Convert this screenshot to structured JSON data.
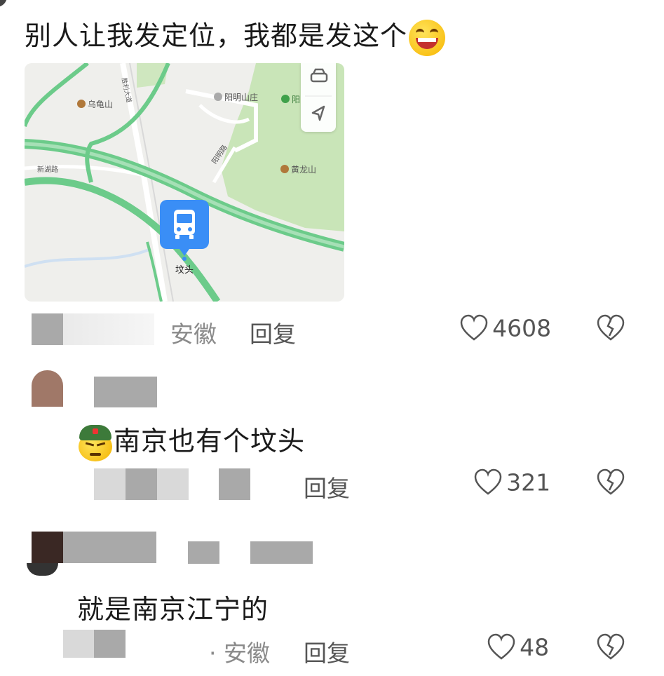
{
  "post": {
    "text": "别人让我发定位，我都是发这个",
    "emoji": "laughing-squinting-emoji",
    "map": {
      "labels": {
        "wuguishan": "乌龟山",
        "yangmingshanzhuang": "阳明山庄",
        "yang": "阳",
        "huanglongshan": "黄龙山",
        "yangminglu": "阳明路",
        "xindelu": "新湖路",
        "road_vertical": "胜利大道",
        "fentou": "坟头"
      },
      "controls": [
        "car-icon",
        "navigate-arrow-icon"
      ],
      "marker_icon": "bus-icon"
    },
    "location": "安徽",
    "reply_label": "回复",
    "likes": "4608"
  },
  "comments": [
    {
      "emoji": "army-helmet-emoji",
      "text": "南京也有个坟头",
      "reply_label": "回复",
      "likes": "321"
    },
    {
      "text": "就是南京江宁的",
      "location": "· 安徽",
      "reply_label": "回复",
      "likes": "48"
    }
  ],
  "icons": {
    "like": "heart-outline-icon",
    "dislike": "broken-heart-icon"
  },
  "colors": {
    "map_green_road": "#6ccb8a",
    "bus_marker": "#3a8ef6",
    "text_gray": "#8a8a8a"
  }
}
